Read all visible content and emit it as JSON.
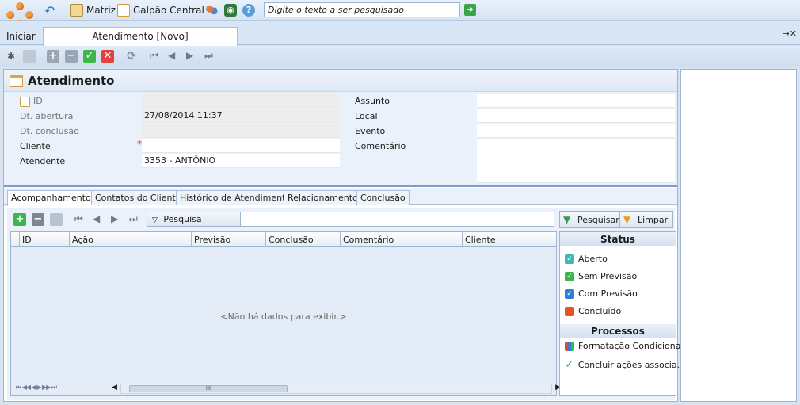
{
  "topbar": {
    "company": "Matriz",
    "branch": "Galpão Central",
    "search_placeholder": "Digite o texto a ser pesquisado"
  },
  "tabs": {
    "start": "Iniciar",
    "document": "Atendimento [Novo]"
  },
  "form": {
    "title": "Atendimento",
    "fields": {
      "id_label": "ID",
      "dt_abertura_label": "Dt. abertura",
      "dt_abertura_value": "27/08/2014 11:37",
      "dt_conclusao_label": "Dt. conclusão",
      "cliente_label": "Cliente",
      "required_mark": "*",
      "atendente_label": "Atendente",
      "atendente_value": "3353 - ANTÔNIO",
      "assunto_label": "Assunto",
      "local_label": "Local",
      "evento_label": "Evento",
      "comentario_label": "Comentário"
    }
  },
  "subtabs": [
    "Acompanhamentos",
    "Contatos do Cliente",
    "Histórico de Atendimentos",
    "Relacionamentos",
    "Conclusão"
  ],
  "grid": {
    "search_button": "Pesquisa",
    "search_action": "Pesquisar",
    "clear_action": "Limpar",
    "columns": [
      "ID",
      "Ação",
      "Previsão",
      "Conclusão",
      "Comentário",
      "Cliente"
    ],
    "empty_message": "<Não há dados para exibir.>",
    "nav_glyphs": "⏮ ◀◀ ◀ ▶ ▶▶ ⏭",
    "scroll_thumb": "III"
  },
  "status_panel": {
    "status_header": "Status",
    "items": [
      {
        "label": "Aberto",
        "color": "#3fb8b0"
      },
      {
        "label": "Sem Previsão",
        "color": "#3cb54a"
      },
      {
        "label": "Com Previsão",
        "color": "#2d7fd6"
      },
      {
        "label": "Concluído",
        "color": "#e8502a"
      }
    ],
    "process_header": "Processos",
    "processes": [
      "Formatação Condicional",
      "Concluir ações associa..."
    ]
  }
}
